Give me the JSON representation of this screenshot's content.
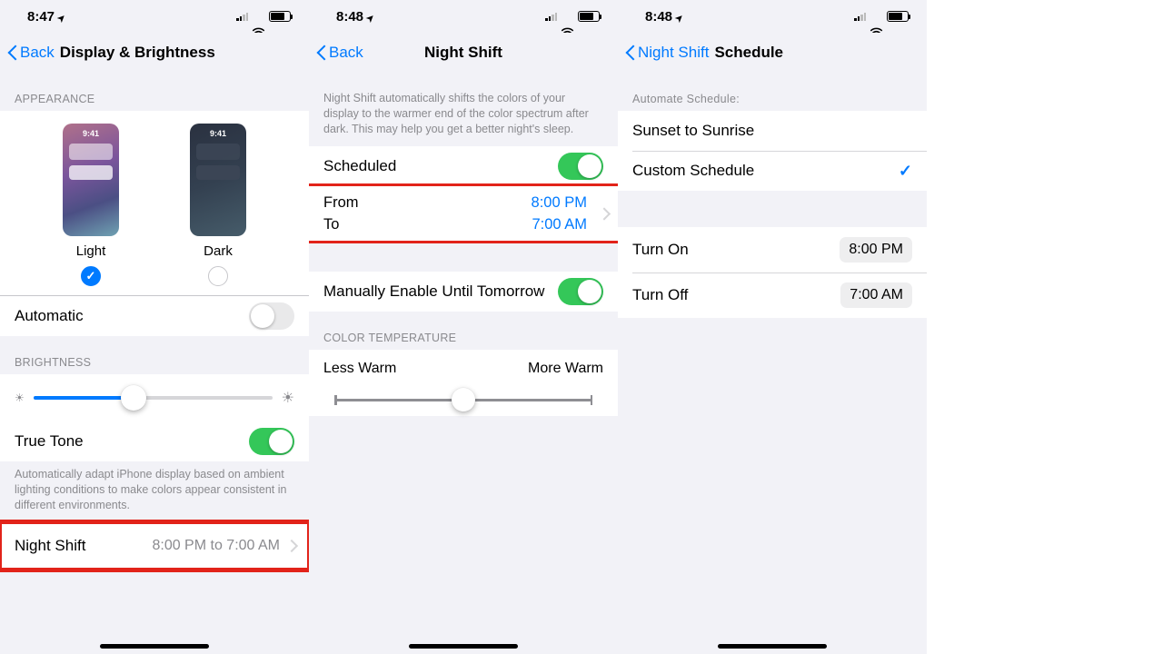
{
  "phone1": {
    "time": "8:47",
    "back": "Back",
    "title": "Display & Brightness",
    "appearance_header": "Appearance",
    "preview_time": "9:41",
    "light_label": "Light",
    "dark_label": "Dark",
    "automatic_label": "Automatic",
    "brightness_header": "Brightness",
    "truetone_label": "True Tone",
    "truetone_footer": "Automatically adapt iPhone display based on ambient lighting conditions to make colors appear consistent in different environments.",
    "nightshift_label": "Night Shift",
    "nightshift_detail": "8:00 PM to 7:00 AM"
  },
  "phone2": {
    "time": "8:48",
    "back": "Back",
    "title": "Night Shift",
    "intro": "Night Shift automatically shifts the colors of your display to the warmer end of the color spectrum after dark. This may help you get a better night's sleep.",
    "scheduled_label": "Scheduled",
    "from_label": "From",
    "from_value": "8:00 PM",
    "to_label": "To",
    "to_value": "7:00 AM",
    "manual_label": "Manually Enable Until Tomorrow",
    "temp_header": "Color Temperature",
    "less_warm": "Less Warm",
    "more_warm": "More Warm"
  },
  "phone3": {
    "time": "8:48",
    "back": "Night Shift",
    "title": "Schedule",
    "automate_header": "Automate Schedule:",
    "opt_sunset": "Sunset to Sunrise",
    "opt_custom": "Custom Schedule",
    "turn_on_label": "Turn On",
    "turn_on_value": "8:00 PM",
    "turn_off_label": "Turn Off",
    "turn_off_value": "7:00 AM"
  }
}
